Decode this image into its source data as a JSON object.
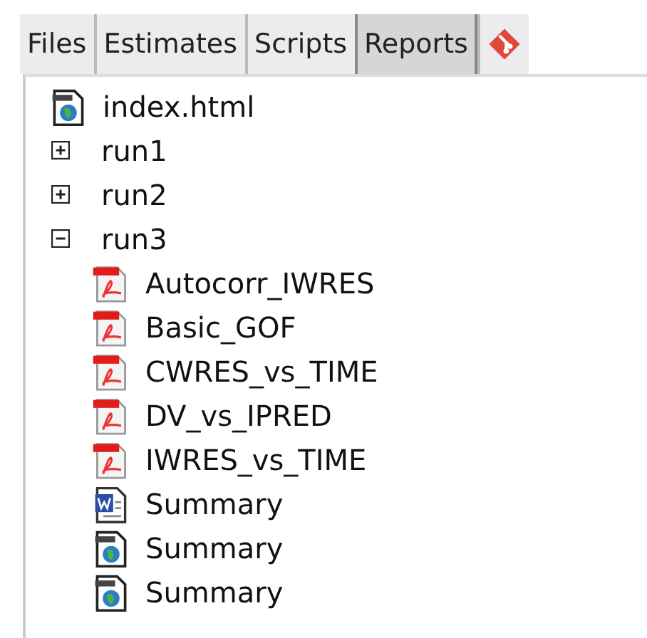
{
  "tabs": [
    {
      "kind": "text",
      "label": "Files",
      "selected": false
    },
    {
      "kind": "text",
      "label": "Estimates",
      "selected": false
    },
    {
      "kind": "text",
      "label": "Scripts",
      "selected": false
    },
    {
      "kind": "text",
      "label": "Reports",
      "selected": true
    },
    {
      "kind": "git",
      "selected": false
    }
  ],
  "tree": [
    {
      "kind": "html",
      "label": "index.html"
    },
    {
      "kind": "folder",
      "label": "run1",
      "expanded": false
    },
    {
      "kind": "folder",
      "label": "run2",
      "expanded": false
    },
    {
      "kind": "folder",
      "label": "run3",
      "expanded": true,
      "children": [
        {
          "kind": "pdf",
          "label": "Autocorr_IWRES"
        },
        {
          "kind": "pdf",
          "label": "Basic_GOF"
        },
        {
          "kind": "pdf",
          "label": "CWRES_vs_TIME"
        },
        {
          "kind": "pdf",
          "label": "DV_vs_IPRED"
        },
        {
          "kind": "pdf",
          "label": "IWRES_vs_TIME"
        },
        {
          "kind": "word",
          "label": "Summary"
        },
        {
          "kind": "html",
          "label": "Summary"
        },
        {
          "kind": "html",
          "label": "Summary"
        }
      ]
    }
  ]
}
